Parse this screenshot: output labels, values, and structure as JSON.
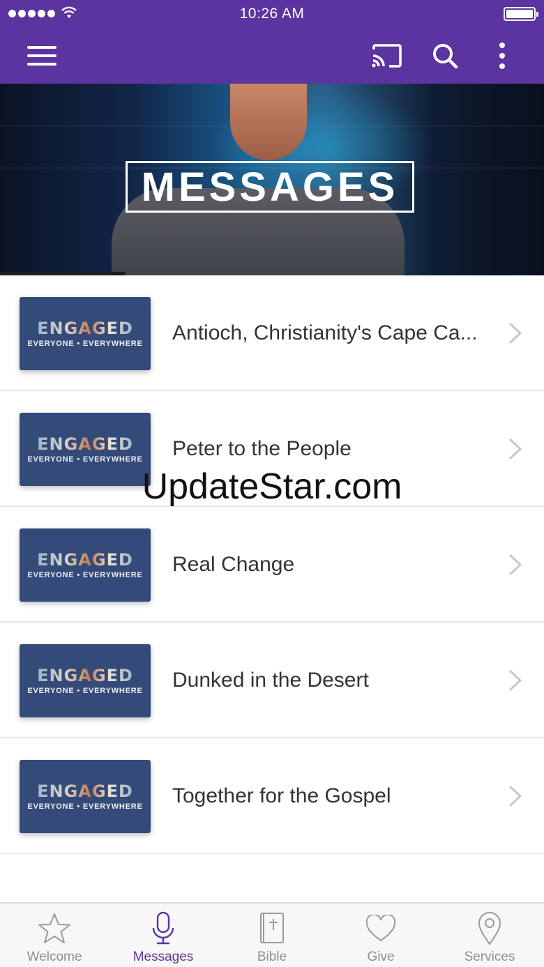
{
  "status_bar": {
    "time": "10:26 AM"
  },
  "hero": {
    "title": "MESSAGES"
  },
  "thumbnail": {
    "title": "ENGAGED",
    "subtitle": "EVERYONE  •  EVERYWHERE"
  },
  "messages": [
    {
      "title": "Antioch, Christianity's Cape Ca..."
    },
    {
      "title": "Peter to the People"
    },
    {
      "title": "Real Change"
    },
    {
      "title": "Dunked in the Desert"
    },
    {
      "title": "Together for the Gospel"
    }
  ],
  "watermark": "UpdateStar.com",
  "tabs": [
    {
      "label": "Welcome",
      "icon": "star-icon"
    },
    {
      "label": "Messages",
      "icon": "microphone-icon",
      "active": true
    },
    {
      "label": "Bible",
      "icon": "bible-icon"
    },
    {
      "label": "Give",
      "icon": "heart-icon"
    },
    {
      "label": "Services",
      "icon": "location-pin-icon"
    }
  ],
  "colors": {
    "accent": "#5b34a0",
    "thumbnail_bg": "#344a79",
    "tab_inactive": "#8f8f8f"
  }
}
